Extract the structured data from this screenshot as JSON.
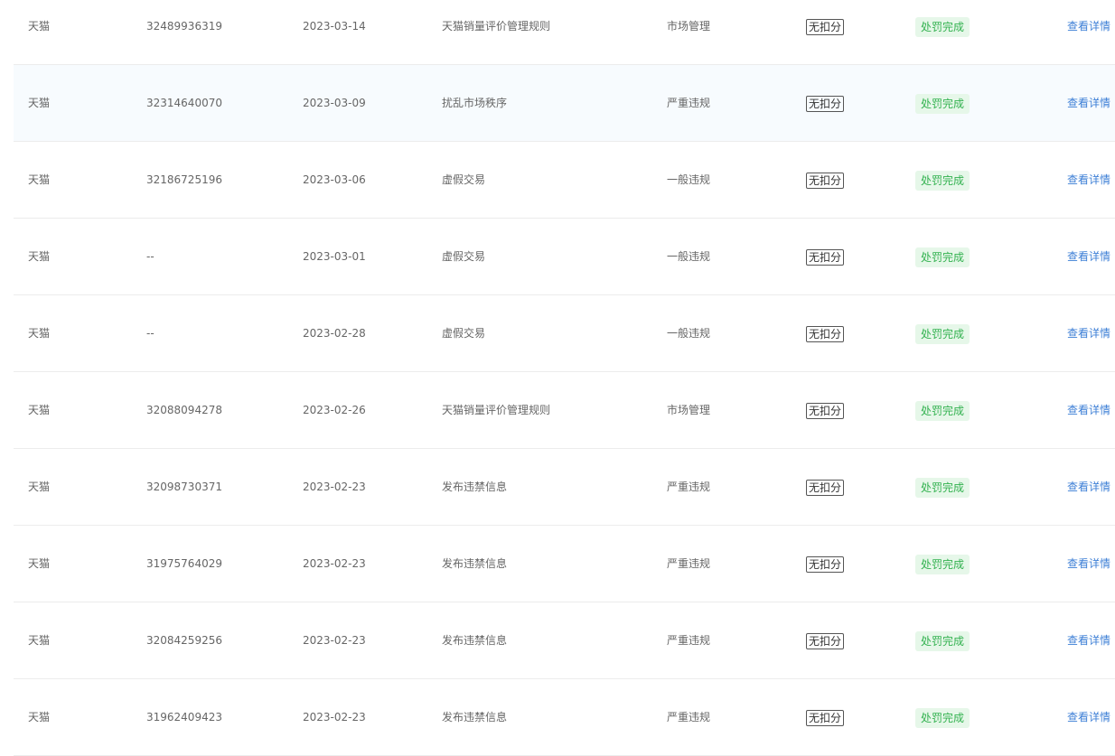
{
  "rows": [
    {
      "platform": "天猫",
      "id": "32489936319",
      "date": "2023-03-14",
      "reason": "天猫销量评价管理规则",
      "type": "市场管理",
      "score": "无扣分",
      "status": "处罚完成",
      "action": "查看详情"
    },
    {
      "platform": "天猫",
      "id": "32314640070",
      "date": "2023-03-09",
      "reason": "扰乱市场秩序",
      "type": "严重违规",
      "score": "无扣分",
      "status": "处罚完成",
      "action": "查看详情"
    },
    {
      "platform": "天猫",
      "id": "32186725196",
      "date": "2023-03-06",
      "reason": "虚假交易",
      "type": "一般违规",
      "score": "无扣分",
      "status": "处罚完成",
      "action": "查看详情"
    },
    {
      "platform": "天猫",
      "id": "--",
      "date": "2023-03-01",
      "reason": "虚假交易",
      "type": "一般违规",
      "score": "无扣分",
      "status": "处罚完成",
      "action": "查看详情"
    },
    {
      "platform": "天猫",
      "id": "--",
      "date": "2023-02-28",
      "reason": "虚假交易",
      "type": "一般违规",
      "score": "无扣分",
      "status": "处罚完成",
      "action": "查看详情"
    },
    {
      "platform": "天猫",
      "id": "32088094278",
      "date": "2023-02-26",
      "reason": "天猫销量评价管理规则",
      "type": "市场管理",
      "score": "无扣分",
      "status": "处罚完成",
      "action": "查看详情"
    },
    {
      "platform": "天猫",
      "id": "32098730371",
      "date": "2023-02-23",
      "reason": "发布违禁信息",
      "type": "严重违规",
      "score": "无扣分",
      "status": "处罚完成",
      "action": "查看详情"
    },
    {
      "platform": "天猫",
      "id": "31975764029",
      "date": "2023-02-23",
      "reason": "发布违禁信息",
      "type": "严重违规",
      "score": "无扣分",
      "status": "处罚完成",
      "action": "查看详情"
    },
    {
      "platform": "天猫",
      "id": "32084259256",
      "date": "2023-02-23",
      "reason": "发布违禁信息",
      "type": "严重违规",
      "score": "无扣分",
      "status": "处罚完成",
      "action": "查看详情"
    },
    {
      "platform": "天猫",
      "id": "31962409423",
      "date": "2023-02-23",
      "reason": "发布违禁信息",
      "type": "严重违规",
      "score": "无扣分",
      "status": "处罚完成",
      "action": "查看详情"
    }
  ],
  "colors": {
    "link": "#3d7fd6",
    "status_text": "#33b250",
    "status_bg": "#e6f7e9",
    "hover_row_bg": "#f7fbfe"
  }
}
